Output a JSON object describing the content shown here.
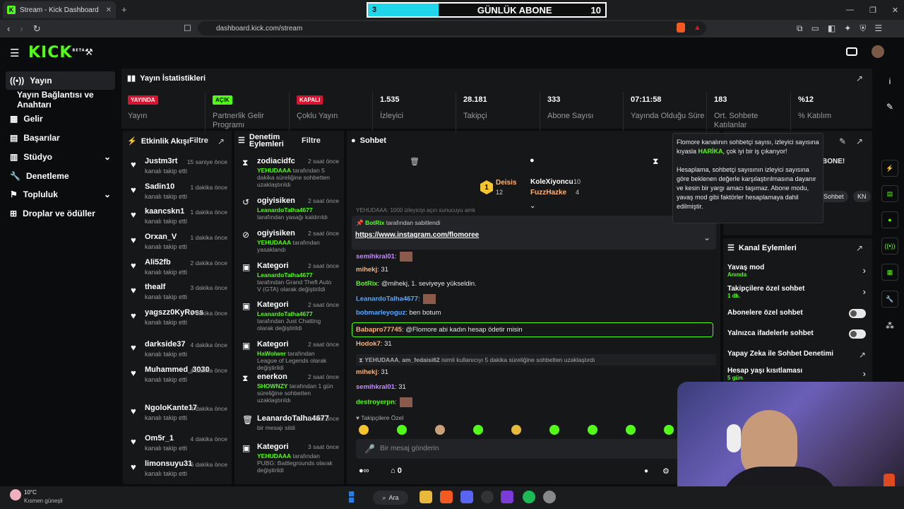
{
  "browser": {
    "tab_title": "Stream - Kick Dashboard",
    "new_tab": "+",
    "url": "dashboard.kick.com/stream",
    "win_min": "—",
    "win_max": "❐",
    "win_close": "✕"
  },
  "goal": {
    "current": "3",
    "label": "GÜNLÜK ABONE",
    "target": "10"
  },
  "app": {
    "logo": "KICK",
    "beta": "BETA"
  },
  "sidebar": {
    "items": [
      {
        "label": "Yayın"
      },
      {
        "label": "Yayın Bağlantısı ve Anahtarı"
      },
      {
        "label": "Gelir"
      },
      {
        "label": "Başarılar"
      },
      {
        "label": "Stüdyo"
      },
      {
        "label": "Denetleme"
      },
      {
        "label": "Topluluk"
      },
      {
        "label": "Droplar ve ödüller"
      }
    ]
  },
  "stats": {
    "title": "Yayın İstatistikleri",
    "items": [
      {
        "value": "YAYINDA",
        "label": "Yayın"
      },
      {
        "value": "AÇIK",
        "label": "Partnerlik Gelir Programı"
      },
      {
        "value": "KAPALI",
        "label": "Çoklu Yayın"
      },
      {
        "value": "1.535",
        "label": "İzleyici"
      },
      {
        "value": "28.181",
        "label": "Takipçi"
      },
      {
        "value": "333",
        "label": "Abone Sayısı"
      },
      {
        "value": "07:11:58",
        "label": "Yayında Olduğu Süre"
      },
      {
        "value": "183",
        "label": "Ort. Sohbete Katılanlar"
      },
      {
        "value": "%12",
        "label": "% Katılım"
      }
    ]
  },
  "activity": {
    "title": "Etkinlik Akışı",
    "filter": "Filtre",
    "events": [
      {
        "name": "Justm3rt",
        "sub": "kanalı takip etti",
        "time": "15 saniye önce"
      },
      {
        "name": "Sadin10",
        "sub": "kanalı takip etti",
        "time": "1 dakika önce"
      },
      {
        "name": "kaancskn1",
        "sub": "kanalı takip etti",
        "time": "1 dakika önce"
      },
      {
        "name": "Orxan_V",
        "sub": "kanalı takip etti",
        "time": "1 dakika önce"
      },
      {
        "name": "Ali52fb",
        "sub": "kanalı takip etti",
        "time": "2 dakika önce"
      },
      {
        "name": "thealf",
        "sub": "kanalı takip etti",
        "time": "3 dakika önce"
      },
      {
        "name": "yagszz0KyRoss",
        "sub": "kanalı takip etti",
        "time": "3 dakika önce"
      },
      {
        "name": "darkside37",
        "sub": "kanalı takip etti",
        "time": "4 dakika önce"
      },
      {
        "name": "Muhammed_3030",
        "sub": "kanalı takip etti",
        "time": "4 dakika önce"
      },
      {
        "name": "NgoloKante17",
        "sub": "kanalı takip etti",
        "time": "4 dakika önce"
      },
      {
        "name": "Om5r_1",
        "sub": "kanalı takip etti",
        "time": "4 dakika önce"
      },
      {
        "name": "limonsuyu31",
        "sub": "kanalı takip etti",
        "time": "6 dakika önce"
      }
    ]
  },
  "moderation": {
    "title": "Denetim Eylemleri",
    "filter": "Filtre",
    "items": [
      {
        "icon": "⧗",
        "name": "zodiacidfc",
        "time": "2 saat önce",
        "who": "YEHUDAAA",
        "desc": " tarafından 5 dakika süreliğine sohbetten uzaklaştırıldı"
      },
      {
        "icon": "↺",
        "name": "ogiyisiken",
        "time": "2 saat önce",
        "who": "LeanardoTalha4677",
        "desc": " tarafından yasağı kaldırıldı"
      },
      {
        "icon": "⊘",
        "name": "ogiyisiken",
        "time": "2 saat önce",
        "who": "YEHUDAAA",
        "desc": " tarafından yasaklandı"
      },
      {
        "icon": "▣",
        "name": "Kategori",
        "time": "2 saat önce",
        "who": "LeanardoTalha4677",
        "desc": " tarafından Grand Theft Auto V (GTA) olarak değiştirildi"
      },
      {
        "icon": "▣",
        "name": "Kategori",
        "time": "2 saat önce",
        "who": "LeanardoTalha4677",
        "desc": " tarafından Just Chatting olarak değiştirildi"
      },
      {
        "icon": "▣",
        "name": "Kategori",
        "time": "2 saat önce",
        "who": "HaWolwer",
        "desc": " tarafından League of Legends olarak değiştirildi"
      },
      {
        "icon": "⧗",
        "name": "enerkon",
        "time": "2 saat önce",
        "who": "SHOWNZY",
        "desc": " tarafından 1 gün süreliğine sohbetten uzaklaştırıldı"
      },
      {
        "icon": "🗑",
        "name": "LeanardoTalha4677",
        "time": "3 saat önce",
        "who": "",
        "desc": "bir mesajı sildi"
      },
      {
        "icon": "▣",
        "name": "Kategori",
        "time": "3 saat önce",
        "who": "YEHUDAAA",
        "desc": " tarafından PUBG: Battlegrounds olarak değiştirildi"
      }
    ]
  },
  "chat": {
    "title": "Sohbet",
    "leaders": [
      {
        "rank": "1",
        "name": "Deisis",
        "count": "12"
      },
      {
        "name": "KoleXiyoncu",
        "count": "10"
      },
      {
        "name": "FuzzHazke",
        "count": "4"
      }
    ],
    "pinned": {
      "by": "BotRix",
      "by_suffix": "tarafından sabitlendi",
      "link": "https://www.instagram.com/flomoree"
    },
    "partial_top": "YEHUDAAA: 1000 izleyiciyi açın sunucuyu amk",
    "messages": [
      {
        "user": "semihkral01",
        "text": "",
        "color": "#c58cff"
      },
      {
        "user": "mihekj",
        "text": "31",
        "color": "#ffb27a"
      },
      {
        "user": "BotRix",
        "text": "@mihekj, 1. seviyeye yükseldin.",
        "color": "#53fc18"
      },
      {
        "user": "LeanardoTalha4677",
        "text": "",
        "color": "#5aa8ff"
      },
      {
        "user": "bobmarleyoguz",
        "text": "ben botum",
        "color": "#5aa8ff"
      },
      {
        "user": "Babapro77745",
        "text": "@Flomore abi kadın hesap ödetir misin",
        "color": "#ffb27a"
      },
      {
        "user": "Hodok7",
        "text": "31",
        "color": "#ffb27a"
      },
      {
        "user": "mihekj",
        "text": "31",
        "color": "#ffb27a"
      },
      {
        "user": "semihkral01",
        "text": "31",
        "color": "#c58cff"
      },
      {
        "user": "destroyerpn",
        "text": "",
        "color": "#53fc18"
      }
    ],
    "timeout_note": {
      "mod": "YEHUDAAA",
      "target": "am_fedaisi62",
      "text": "isimli kullanıcıyı 5 dakika süreliğine sohbetten uzaklaştırdı"
    },
    "followers_only": "Takipçilere Özel",
    "input_placeholder": "Bir mesaj gönderin",
    "points": "0"
  },
  "tooltip": {
    "l1": "Flomore kanalının sohbetçi sayısı, izleyici sayısına kıyasla ",
    "strong": "HARİKA",
    "l2": ", çok iyi bir iş çıkarıyor!",
    "p2": "Hesaplama, sohbetçi sayısının izleyici sayısına göre beklenen değerle karşılaştırılmasına dayanır ve kesin bir yargı amacı taşımaz. Abone modu, yavaş mod gibi faktörler hesaplamaya dahil edilmiştir."
  },
  "right_panel": {
    "partial_text": "BONE!",
    "chip1": "Sohbet",
    "chip2": "KN"
  },
  "channel_actions": {
    "title": "Kanal Eylemleri",
    "items": [
      {
        "label": "Yavaş mod",
        "sub": "Anında"
      },
      {
        "label": "Takipçilere özel sohbet",
        "sub": "1 dk."
      },
      {
        "label": "Abonelere özel sohbet",
        "sub": ""
      },
      {
        "label": "Yalnızca ifadelerle sohbet",
        "sub": ""
      },
      {
        "label": "Yapay Zeka ile Sohbet Denetimi",
        "sub": ""
      },
      {
        "label": "Hesap yaşı kısıtlaması",
        "sub": "5 gün"
      }
    ]
  },
  "taskbar": {
    "temp": "10°C",
    "weather": "Kısmen güneşli",
    "search": "Ara"
  }
}
